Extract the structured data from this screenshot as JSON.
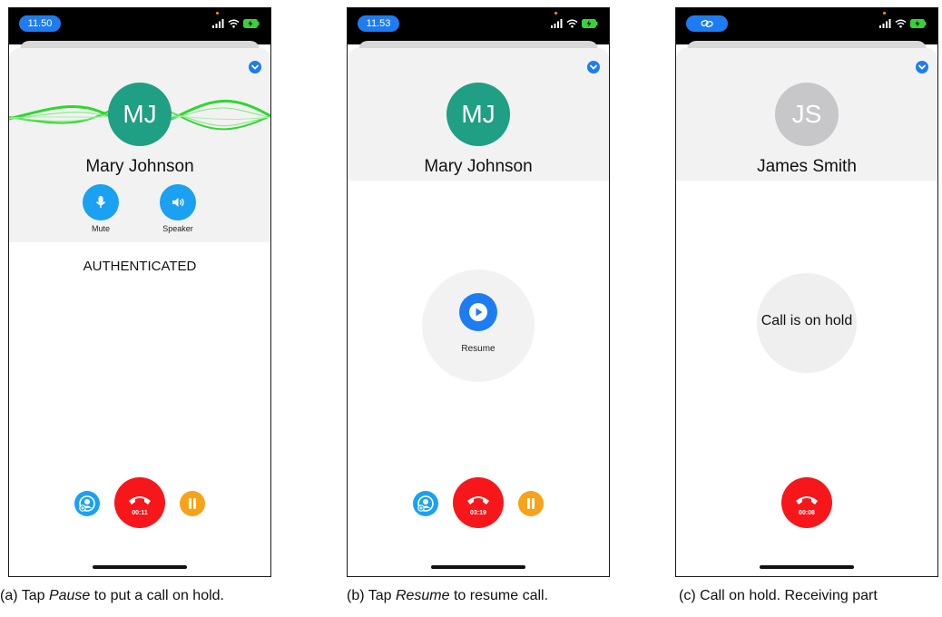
{
  "colors": {
    "accent_blue": "#1e7cf2",
    "control_blue": "#1ba1f2",
    "end_call_red": "#f7171b",
    "pause_orange": "#f8a21a",
    "avatar_teal": "#1f9f83",
    "avatar_gray": "#c7c7c9",
    "wave_green": "#2bd92b"
  },
  "screens": {
    "a": {
      "time": "11.50",
      "avatar_initials": "MJ",
      "contact_name": "Mary Johnson",
      "mute_label": "Mute",
      "speaker_label": "Speaker",
      "status_text": "AUTHENTICATED",
      "call_timer": "00:11",
      "caption_prefix": "(a) Tap ",
      "caption_em": "Pause",
      "caption_suffix": " to put a call on hold."
    },
    "b": {
      "time": "11.53",
      "avatar_initials": "MJ",
      "contact_name": "Mary Johnson",
      "resume_label": "Resume",
      "call_timer": "03:19",
      "caption_prefix": "(b) Tap ",
      "caption_em": "Resume",
      "caption_suffix": " to resume call."
    },
    "c": {
      "avatar_initials": "JS",
      "contact_name": "James Smith",
      "hold_text": "Call is on hold",
      "call_timer": "00:08",
      "caption": "(c) Call on hold. Receiving part"
    }
  },
  "icons": [
    "signal-icon",
    "wifi-icon",
    "battery-charging-icon",
    "chevron-down-icon",
    "microphone-icon",
    "speaker-icon",
    "transfer-icon",
    "hang-up-icon",
    "pause-icon",
    "play-icon",
    "link-icon"
  ]
}
